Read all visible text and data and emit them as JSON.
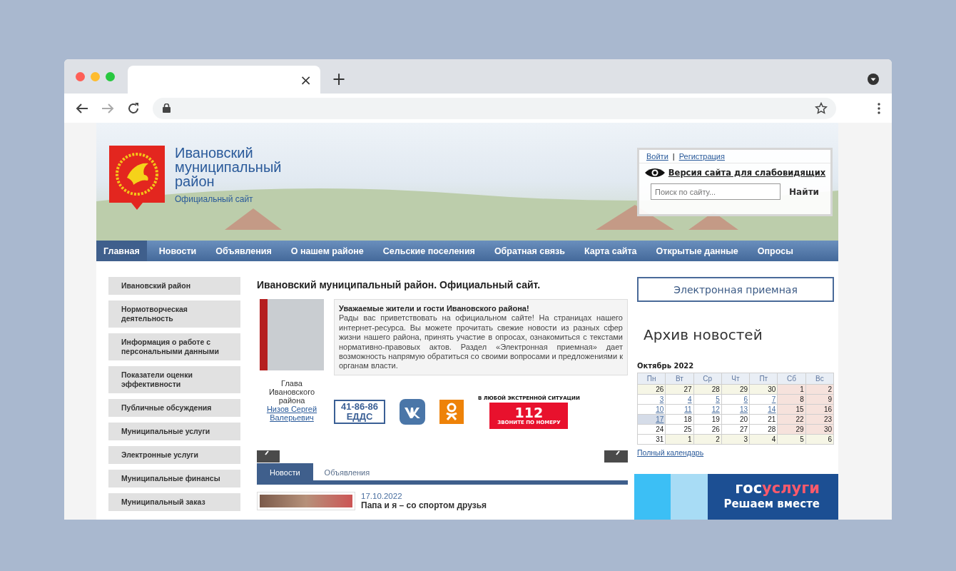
{
  "browser": {
    "tab_close": "×",
    "new_tab": "+"
  },
  "header": {
    "title_lines": [
      "Ивановский",
      "муниципальный",
      "район"
    ],
    "subtitle": "Официальный сайт",
    "login": "Войти",
    "separator": "|",
    "register": "Регистрация",
    "accessibility": "Версия сайта для слабовидящих",
    "search": {
      "placeholder": "Поиск по сайту..."
    },
    "search_button": "Найти"
  },
  "nav": [
    {
      "label": "Главная",
      "selected": true
    },
    {
      "label": "Новости",
      "selected": false
    },
    {
      "label": "Объявления",
      "selected": false
    },
    {
      "label": "О нашем районе",
      "selected": false
    },
    {
      "label": "Сельские поселения",
      "selected": false
    },
    {
      "label": "Обратная связь",
      "selected": false
    },
    {
      "label": "Карта сайта",
      "selected": false
    },
    {
      "label": "Открытые данные",
      "selected": false
    },
    {
      "label": "Опросы",
      "selected": false
    }
  ],
  "sidebar": {
    "items": [
      "Ивановский район",
      "Нормотворческая деятельность",
      "Информация о работе с персональными данными",
      "Показатели оценки эффективности",
      "Публичные обсуждения",
      "Муниципальные услуги",
      "Электронные услуги",
      "Муниципальные финансы",
      "Муниципальный заказ"
    ]
  },
  "main": {
    "heading": "Ивановский муниципальный район. Официальный сайт.",
    "head_caption": "Главa Ивановского района",
    "head_name": "Низов Сергей Валерьевич",
    "greeting_title": "Уважаемые жители и гости Ивановского района!",
    "greeting_text": "Рады вас приветствовать на официальном сайте! На страницах нашего интернет-ресурса. Вы можете прочитать свежие новости из разных сфер жизни нашего района, принять участие в опросах, ознакомиться с текстами нормативно-правовых актов. Раздел «Электронная приемная» дает возможность напрямую обратиться со своими вопросами и предложениями к органам власти.",
    "edds_phone": "41-86-86",
    "edds_label": "ЕДДС",
    "emergency_top": "В ЛЮБОЙ ЭКСТРЕННОЙ СИТУАЦИИ",
    "emergency_number": "112",
    "emergency_bottom": "ЗВОНИТЕ ПО НОМЕРУ",
    "tabs": [
      {
        "label": "Новости",
        "selected": true
      },
      {
        "label": "Объявления",
        "selected": false
      }
    ],
    "news": [
      {
        "date": "17.10.2022",
        "title": "Папа и я – со спортом друзья"
      }
    ]
  },
  "right": {
    "reception_button": "Электронная приемная",
    "archive_title": "Архив новостей",
    "calendar": {
      "month": "Октябрь 2022",
      "weekdays": [
        "Пн",
        "Вт",
        "Ср",
        "Чт",
        "Пт",
        "Сб",
        "Вс"
      ],
      "weeks": [
        [
          {
            "day": "26",
            "kind": "other",
            "link": false,
            "selected": false
          },
          {
            "day": "27",
            "kind": "other",
            "link": false,
            "selected": false
          },
          {
            "day": "28",
            "kind": "other",
            "link": false,
            "selected": false
          },
          {
            "day": "29",
            "kind": "other",
            "link": false,
            "selected": false
          },
          {
            "day": "30",
            "kind": "other",
            "link": false,
            "selected": false
          },
          {
            "day": "1",
            "kind": "weekend",
            "link": false,
            "selected": false
          },
          {
            "day": "2",
            "kind": "weekend",
            "link": false,
            "selected": false
          }
        ],
        [
          {
            "day": "3",
            "kind": "day",
            "link": true,
            "selected": false
          },
          {
            "day": "4",
            "kind": "day",
            "link": true,
            "selected": false
          },
          {
            "day": "5",
            "kind": "day",
            "link": true,
            "selected": false
          },
          {
            "day": "6",
            "kind": "day",
            "link": true,
            "selected": false
          },
          {
            "day": "7",
            "kind": "day",
            "link": true,
            "selected": false
          },
          {
            "day": "8",
            "kind": "weekend",
            "link": false,
            "selected": false
          },
          {
            "day": "9",
            "kind": "weekend",
            "link": false,
            "selected": false
          }
        ],
        [
          {
            "day": "10",
            "kind": "day",
            "link": true,
            "selected": false
          },
          {
            "day": "11",
            "kind": "day",
            "link": true,
            "selected": false
          },
          {
            "day": "12",
            "kind": "day",
            "link": true,
            "selected": false
          },
          {
            "day": "13",
            "kind": "day",
            "link": true,
            "selected": false
          },
          {
            "day": "14",
            "kind": "day",
            "link": true,
            "selected": false
          },
          {
            "day": "15",
            "kind": "weekend",
            "link": false,
            "selected": false
          },
          {
            "day": "16",
            "kind": "weekend",
            "link": false,
            "selected": false
          }
        ],
        [
          {
            "day": "17",
            "kind": "day",
            "link": true,
            "selected": true
          },
          {
            "day": "18",
            "kind": "day",
            "link": false,
            "selected": false
          },
          {
            "day": "19",
            "kind": "day",
            "link": false,
            "selected": false
          },
          {
            "day": "20",
            "kind": "day",
            "link": false,
            "selected": false
          },
          {
            "day": "21",
            "kind": "day",
            "link": false,
            "selected": false
          },
          {
            "day": "22",
            "kind": "weekend",
            "link": false,
            "selected": false
          },
          {
            "day": "23",
            "kind": "weekend",
            "link": false,
            "selected": false
          }
        ],
        [
          {
            "day": "24",
            "kind": "day",
            "link": false,
            "selected": false
          },
          {
            "day": "25",
            "kind": "day",
            "link": false,
            "selected": false
          },
          {
            "day": "26",
            "kind": "day",
            "link": false,
            "selected": false
          },
          {
            "day": "27",
            "kind": "day",
            "link": false,
            "selected": false
          },
          {
            "day": "28",
            "kind": "day",
            "link": false,
            "selected": false
          },
          {
            "day": "29",
            "kind": "weekend",
            "link": false,
            "selected": false
          },
          {
            "day": "30",
            "kind": "weekend",
            "link": false,
            "selected": false
          }
        ],
        [
          {
            "day": "31",
            "kind": "day",
            "link": false,
            "selected": false
          },
          {
            "day": "1",
            "kind": "other",
            "link": false,
            "selected": false
          },
          {
            "day": "2",
            "kind": "other",
            "link": false,
            "selected": false
          },
          {
            "day": "3",
            "kind": "other",
            "link": false,
            "selected": false
          },
          {
            "day": "4",
            "kind": "other",
            "link": false,
            "selected": false
          },
          {
            "day": "5",
            "kind": "other",
            "link": false,
            "selected": false
          },
          {
            "day": "6",
            "kind": "other",
            "link": false,
            "selected": false
          }
        ]
      ]
    },
    "full_calendar": "Полный календарь",
    "banner_logo": [
      "гос",
      "услуги"
    ],
    "banner_slogan": "Решаем вместе"
  }
}
